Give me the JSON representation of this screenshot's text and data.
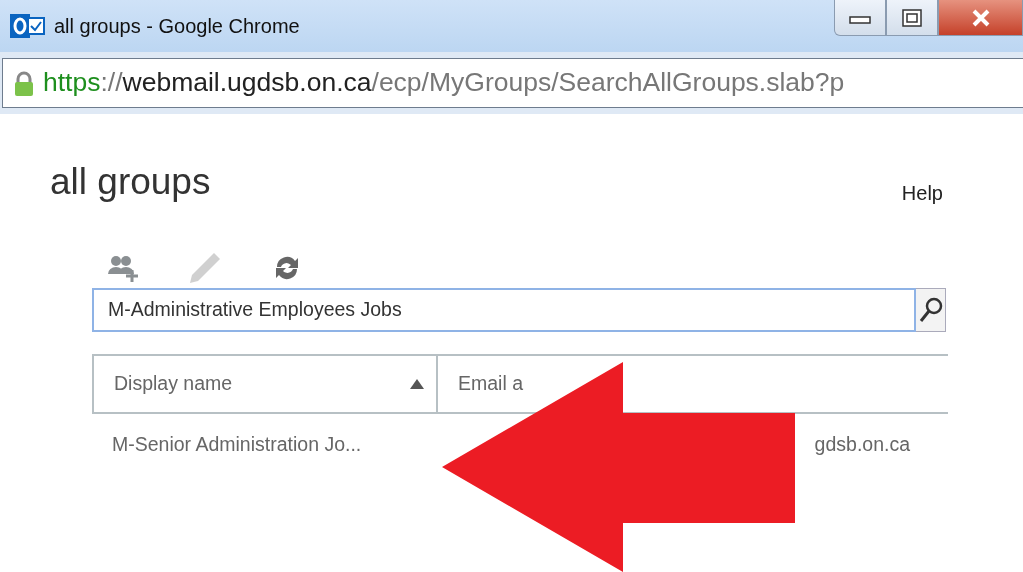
{
  "window": {
    "title": "all groups - Google Chrome"
  },
  "address_bar": {
    "scheme": "https",
    "separator": "://",
    "host": "webmail.ugdsb.on.ca",
    "path": "/ecp/MyGroups/SearchAllGroups.slab?p"
  },
  "page": {
    "title": "all groups",
    "help": "Help"
  },
  "toolbar": [
    {
      "kind": "add-group",
      "disabled": false
    },
    {
      "kind": "edit",
      "disabled": true
    },
    {
      "kind": "refresh",
      "disabled": false
    }
  ],
  "search": {
    "value": "M-Administrative Employees Jobs"
  },
  "table": {
    "columns": [
      {
        "label": "Display name",
        "sorted": true
      },
      {
        "label": "Email a",
        "sorted": false
      }
    ],
    "rows": [
      [
        "M-Senior Administration Jo...",
        "gdsb.on.ca"
      ]
    ]
  },
  "annotation": {
    "kind": "arrow"
  }
}
